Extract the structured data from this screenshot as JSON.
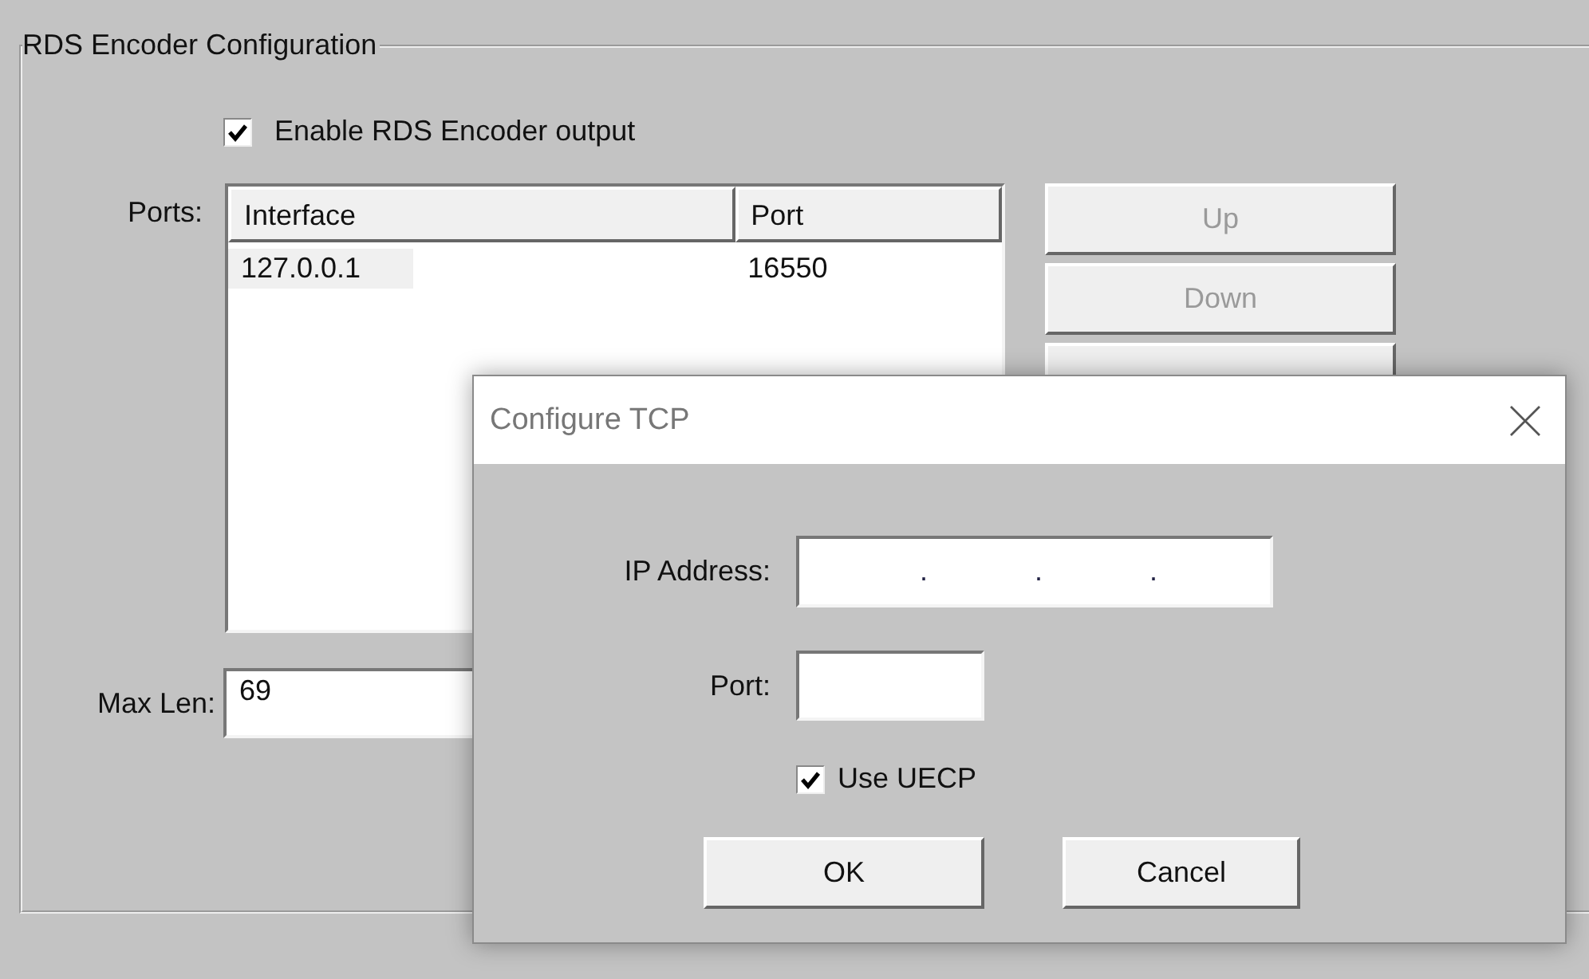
{
  "group_box": {
    "title": "RDS Encoder Configuration"
  },
  "enable_output": {
    "label": "Enable RDS Encoder output",
    "checked": true
  },
  "ports": {
    "label": "Ports:",
    "columns": [
      "Interface",
      "Port"
    ],
    "rows": [
      {
        "cells": [
          "127.0.0.1",
          "16550"
        ],
        "selected": true
      }
    ]
  },
  "side_buttons": [
    {
      "label": "Up",
      "disabled": true
    },
    {
      "label": "Down",
      "disabled": true
    }
  ],
  "max_len": {
    "label": "Max Len:",
    "value": "69"
  },
  "dialog": {
    "title": "Configure TCP",
    "ip_address": {
      "label": "IP Address:",
      "separator": "."
    },
    "port": {
      "label": "Port:"
    },
    "use_uecp": {
      "label": "Use UECP",
      "checked": true
    },
    "buttons": [
      "OK",
      "Cancel"
    ]
  }
}
